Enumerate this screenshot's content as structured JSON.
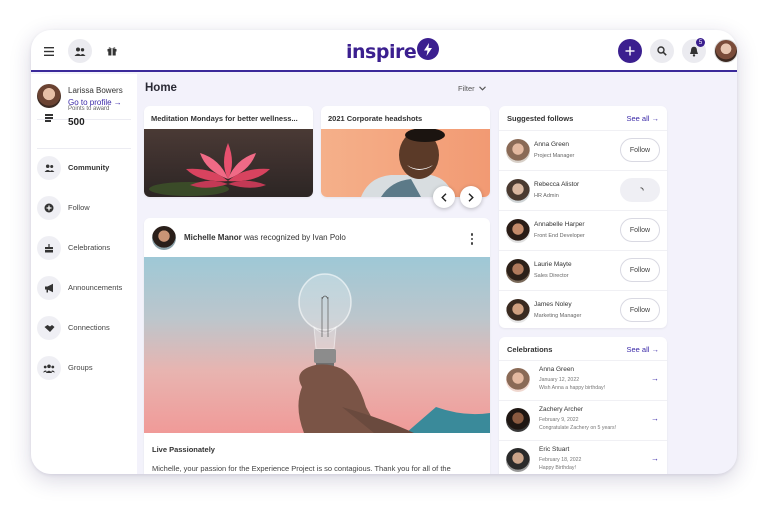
{
  "brand": {
    "name": "inspire",
    "accent": "#3b1f8f",
    "link_color": "#3b2aa8"
  },
  "topbar": {
    "menu_icon": "hamburger-icon",
    "people_icon": "people-icon",
    "gift_icon": "gift-icon",
    "add_icon": "plus-icon",
    "search_icon": "search-icon",
    "bell_icon": "bell-icon",
    "notification_count": "5"
  },
  "sidebar": {
    "profile": {
      "name": "Larissa Bowers",
      "link": "Go to profile →"
    },
    "points": {
      "label": "Points to award",
      "value": "500"
    },
    "items": [
      {
        "label": "Community",
        "icon": "people-icon",
        "active": true
      },
      {
        "label": "Follow",
        "icon": "plus-circle-icon"
      },
      {
        "label": "Celebrations",
        "icon": "cake-icon"
      },
      {
        "label": "Announcements",
        "icon": "megaphone-icon"
      },
      {
        "label": "Connections",
        "icon": "handshake-icon"
      },
      {
        "label": "Groups",
        "icon": "group-icon"
      }
    ]
  },
  "main": {
    "title": "Home",
    "filter_label": "Filter",
    "carousel": [
      {
        "title": "Meditation Mondays for better wellness..."
      },
      {
        "title": "2021 Corporate headshots"
      }
    ],
    "post": {
      "author": "Michelle Manor",
      "action": " was recognized by Ivan Polo",
      "title": "Live Passionately",
      "body": "Michelle, your passion for the Experience Project is so contagious. Thank you for all of the"
    }
  },
  "suggested": {
    "title": "Suggested follows",
    "see_all": "See all →",
    "follow_label": "Follow",
    "people": [
      {
        "name": "Anna Green",
        "role": "Project Manager",
        "state": "follow"
      },
      {
        "name": "Rebecca Alistor",
        "role": "HR Admin",
        "state": "loading"
      },
      {
        "name": "Annabelle Harper",
        "role": "Front End Developer",
        "state": "follow"
      },
      {
        "name": "Laurie Mayte",
        "role": "Sales Director",
        "state": "follow"
      },
      {
        "name": "James Noley",
        "role": "Marketing Manager",
        "state": "follow"
      }
    ]
  },
  "celebrations": {
    "title": "Celebrations",
    "see_all": "See all →",
    "items": [
      {
        "name": "Anna Green",
        "date": "January 12, 2022",
        "message": "Wish Anna a happy birthday!"
      },
      {
        "name": "Zachery Archer",
        "date": "February 9, 2022",
        "message": "Congratulate Zachery on 5 years!"
      },
      {
        "name": "Eric Stuart",
        "date": "February 18, 2022",
        "message": "Happy Birthday!"
      }
    ]
  }
}
